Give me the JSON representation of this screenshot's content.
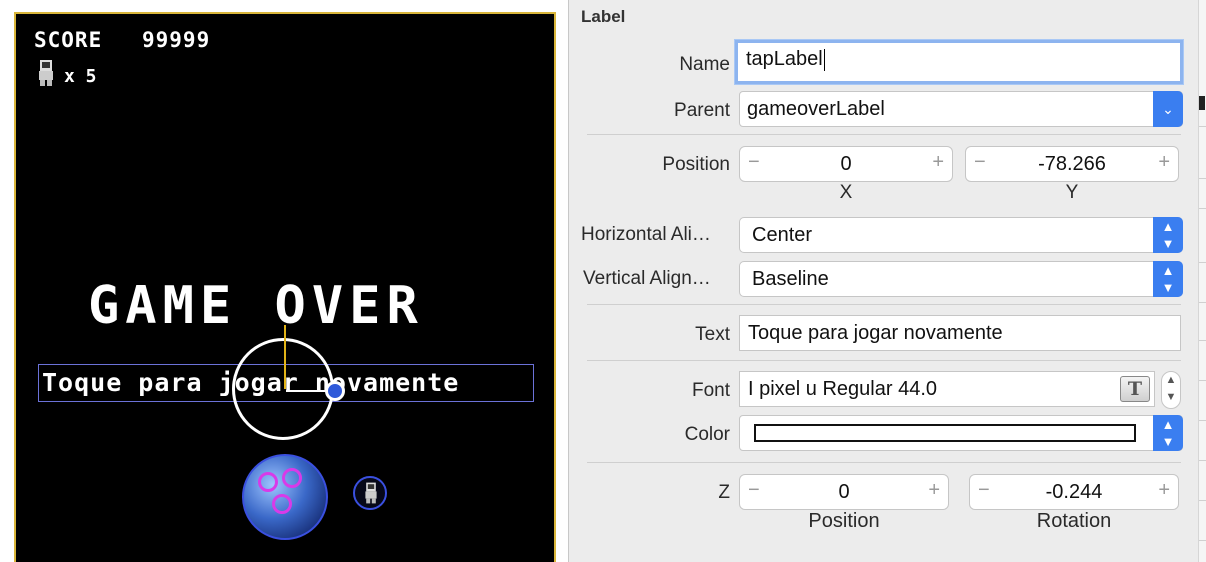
{
  "scene": {
    "hud": {
      "score_label": "SCORE",
      "score_value": "99999",
      "lives_text": "x 5",
      "lives_icon": "astronaut-icon"
    },
    "gameover_text": "GAME OVER",
    "tap_text": "Toque para jogar novamente",
    "colors": {
      "background": "#000000",
      "frame": "#d8b53a",
      "selection": "#6b72d8",
      "anchor": "#2e59d9",
      "rings": "#d83ae8"
    }
  },
  "inspector": {
    "section_title": "Label",
    "name": {
      "label": "Name",
      "value": "tapLabel"
    },
    "parent": {
      "label": "Parent",
      "value": "gameoverLabel"
    },
    "position": {
      "label": "Position",
      "x": "0",
      "y": "-78.266",
      "x_caption": "X",
      "y_caption": "Y"
    },
    "horizontal_align": {
      "label": "Horizontal Ali…",
      "value": "Center"
    },
    "vertical_align": {
      "label": "Vertical Align…",
      "value": "Baseline"
    },
    "text": {
      "label": "Text",
      "value": "Toque para jogar novamente"
    },
    "font": {
      "label": "Font",
      "value": "I pixel u Regular 44.0",
      "icon": "font-panel-icon"
    },
    "color": {
      "label": "Color",
      "value": "#ffffff"
    },
    "z": {
      "label": "Z",
      "position": "0",
      "rotation": "-0.244",
      "position_caption": "Position",
      "rotation_caption": "Rotation"
    },
    "stepper": {
      "minus": "−",
      "plus": "+"
    },
    "accent": "#3a7ef0"
  }
}
